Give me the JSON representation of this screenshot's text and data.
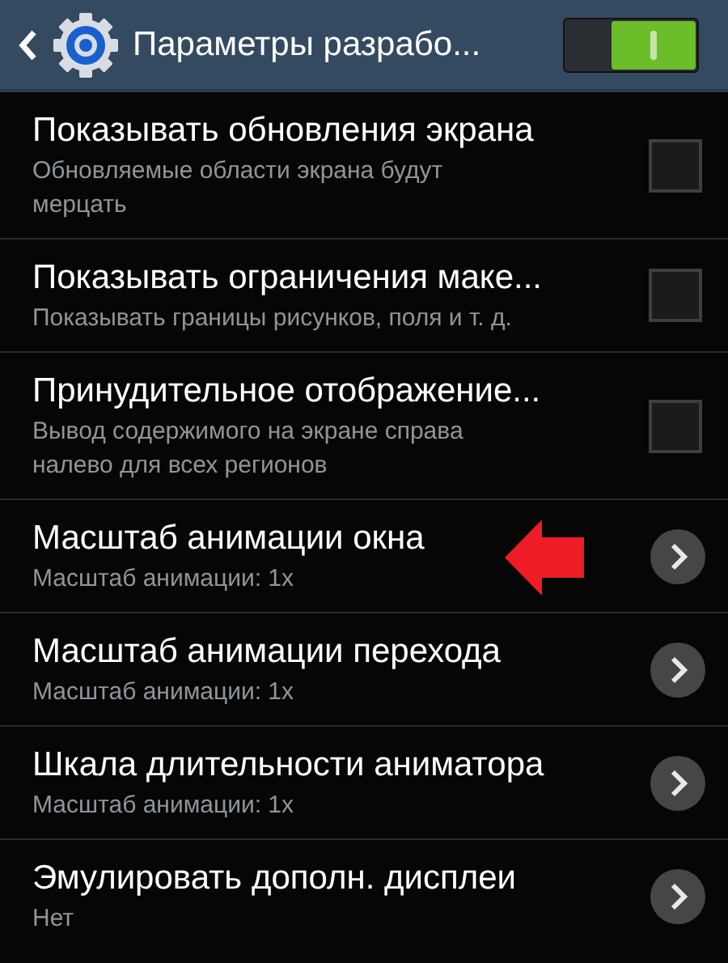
{
  "header": {
    "title": "Параметры разрабо...",
    "switch": {
      "on": true
    }
  },
  "items": [
    {
      "kind": "checkbox",
      "title": "Показывать обновления экрана",
      "summary": "Обновляемые области экрана будут мерцать",
      "checked": false,
      "marked": false
    },
    {
      "kind": "checkbox",
      "title": "Показывать ограничения маке...",
      "summary": "Показывать границы рисунков, поля и т. д.",
      "checked": false,
      "marked": false
    },
    {
      "kind": "checkbox",
      "title": "Принудительное отображение...",
      "summary": "Вывод содержимого на экране справа налево для всех регионов",
      "checked": false,
      "marked": false
    },
    {
      "kind": "link",
      "title": "Масштаб анимации окна",
      "summary": "Масштаб анимации: 1x",
      "marked": true
    },
    {
      "kind": "link",
      "title": "Масштаб анимации перехода",
      "summary": "Масштаб анимации: 1x",
      "marked": false
    },
    {
      "kind": "link",
      "title": "Шкала длительности аниматора",
      "summary": "Масштаб анимации: 1x",
      "marked": false
    },
    {
      "kind": "link",
      "title": "Эмулировать дополн. дисплеи",
      "summary": "Нет",
      "marked": false
    }
  ]
}
